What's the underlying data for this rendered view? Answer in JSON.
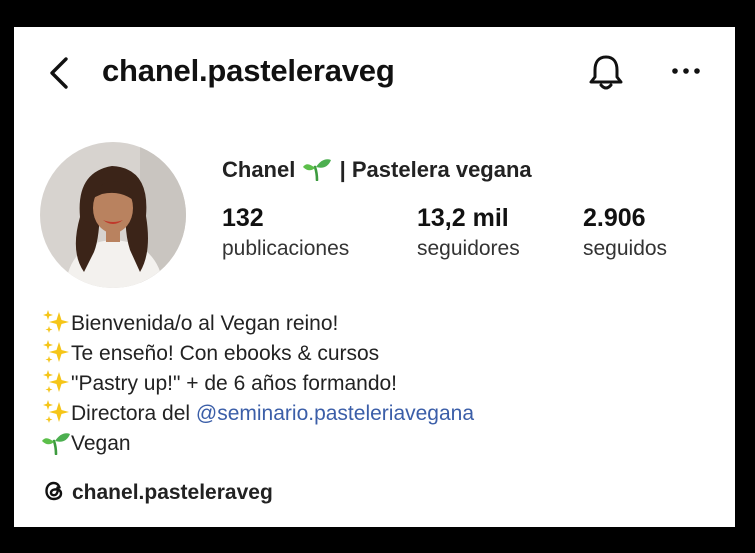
{
  "header": {
    "username": "chanel.pasteleraveg",
    "back_icon": "chevron-left-icon",
    "notification_icon": "bell-icon",
    "more_icon": "more-horizontal-icon"
  },
  "profile": {
    "name_part1": "Chanel",
    "name_emoji": "sprout-icon",
    "name_part2": "| Pastelera vegana",
    "stats": {
      "posts_value": "132",
      "posts_label": "publicaciones",
      "followers_value": "13,2 mil",
      "followers_label": "seguidores",
      "following_value": "2.906",
      "following_label": "seguidos"
    }
  },
  "bio": {
    "line1": "Bienvenida/o al Vegan reino!",
    "line2": "Te enseño! Con ebooks & cursos",
    "line3": "\"Pastry up!\" + de 6 años formando!",
    "line4_prefix": "Directora del ",
    "line4_mention": "@seminario.pasteleriavegana",
    "line5": "Vegan",
    "sparkle_icon": "sparkles-icon",
    "sprout_icon": "sprout-icon"
  },
  "threads": {
    "icon": "threads-icon",
    "handle": "chanel.pasteleraveg"
  },
  "colors": {
    "background": "#ffffff",
    "frame": "#000000",
    "text": "#222222",
    "mention": "#3b5ea8",
    "sparkle": "#f5c518",
    "sprout": "#4caf50"
  }
}
